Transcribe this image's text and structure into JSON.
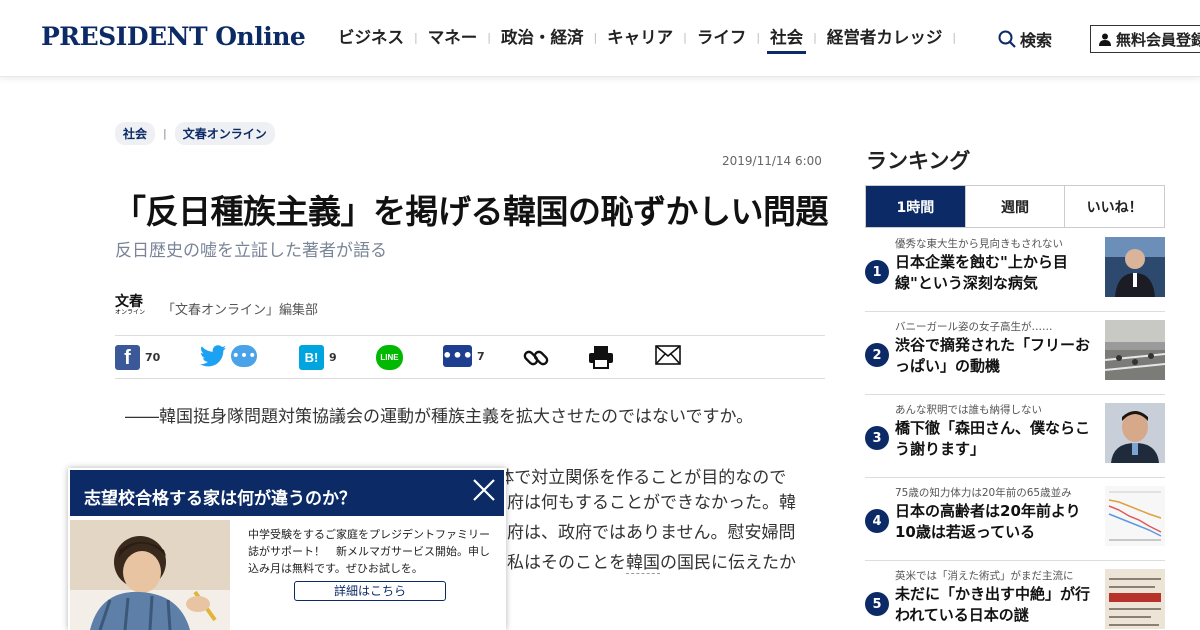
{
  "header": {
    "logo": "PRESIDENT Online",
    "nav": [
      "ビジネス",
      "マネー",
      "政治・経済",
      "キャリア",
      "ライフ",
      "社会",
      "経営者カレッジ"
    ],
    "active_nav": "社会",
    "search_label": "検索",
    "member_label": "無料会員登録"
  },
  "article": {
    "tags": [
      "社会",
      "文春オンライン"
    ],
    "date": "2019/11/14 6:00",
    "title": "「反日種族主義」を掲げる韓国の恥ずかしい問題",
    "subtitle": "反日歴史の嘘を立証した著者が語る",
    "author_logo": "文春",
    "author_logo_sub": "オンライン",
    "author": "「文春オンライン」編集部",
    "share": {
      "facebook_count": "70",
      "hatena_count": "9",
      "hatena_label": "B!",
      "line_label": "LINE",
      "comment_count": "7"
    },
    "paragraph1": "――韓国挺身隊問題対策協議会の運動が種族主義を拡大させたのではないですか。",
    "paragraph2_line1": "李　彼らは基本的に政治団体です。左派の政治団体で対立関係を作ることが目的なので",
    "paragraph2_line2_tail": "府は何もすることができなかった。韓",
    "paragraph2_line3_tail": "府は、政府ではありません。慰安婦問",
    "paragraph2_line4_tail_a": "私はそのことを",
    "paragraph2_line4_tail_link": "韓国",
    "paragraph2_line4_tail_b": "の国民に伝えたか"
  },
  "popup": {
    "title": "志望校合格する家は何が違うのか？",
    "text": "中学受験をするご家庭をプレジデントファミリー誌がサポート！　新メルマガサービス開始。申し込み月は無料です。ぜひお試しを。",
    "button": "詳細はこちら"
  },
  "ranking": {
    "title": "ランキング",
    "tabs": [
      "1時間",
      "週間",
      "いいね！"
    ],
    "active_tab": "1時間",
    "items": [
      {
        "rank": "1",
        "sub": "優秀な東大生から見向きもされない",
        "headline": "日本企業を蝕む\"上から目線\"という深刻な病気"
      },
      {
        "rank": "2",
        "sub": "バニーガール姿の女子高生が……",
        "headline": "渋谷で摘発された「フリーおっぱい」の動機"
      },
      {
        "rank": "3",
        "sub": "あんな釈明では誰も納得しない",
        "headline": "橋下徹「森田さん、僕ならこう謝ります」"
      },
      {
        "rank": "4",
        "sub": "75歳の知力体力は20年前の65歳並み",
        "headline": "日本の高齢者は20年前より10歳は若返っている"
      },
      {
        "rank": "5",
        "sub": "英米では「消えた術式」がまだ主流に",
        "headline": "未だに「かき出す中絶」が行われている日本の謎"
      }
    ]
  },
  "colors": {
    "brand": "#0b2a66",
    "facebook": "#3b5998",
    "hatena": "#00a4de",
    "line": "#00b900"
  }
}
